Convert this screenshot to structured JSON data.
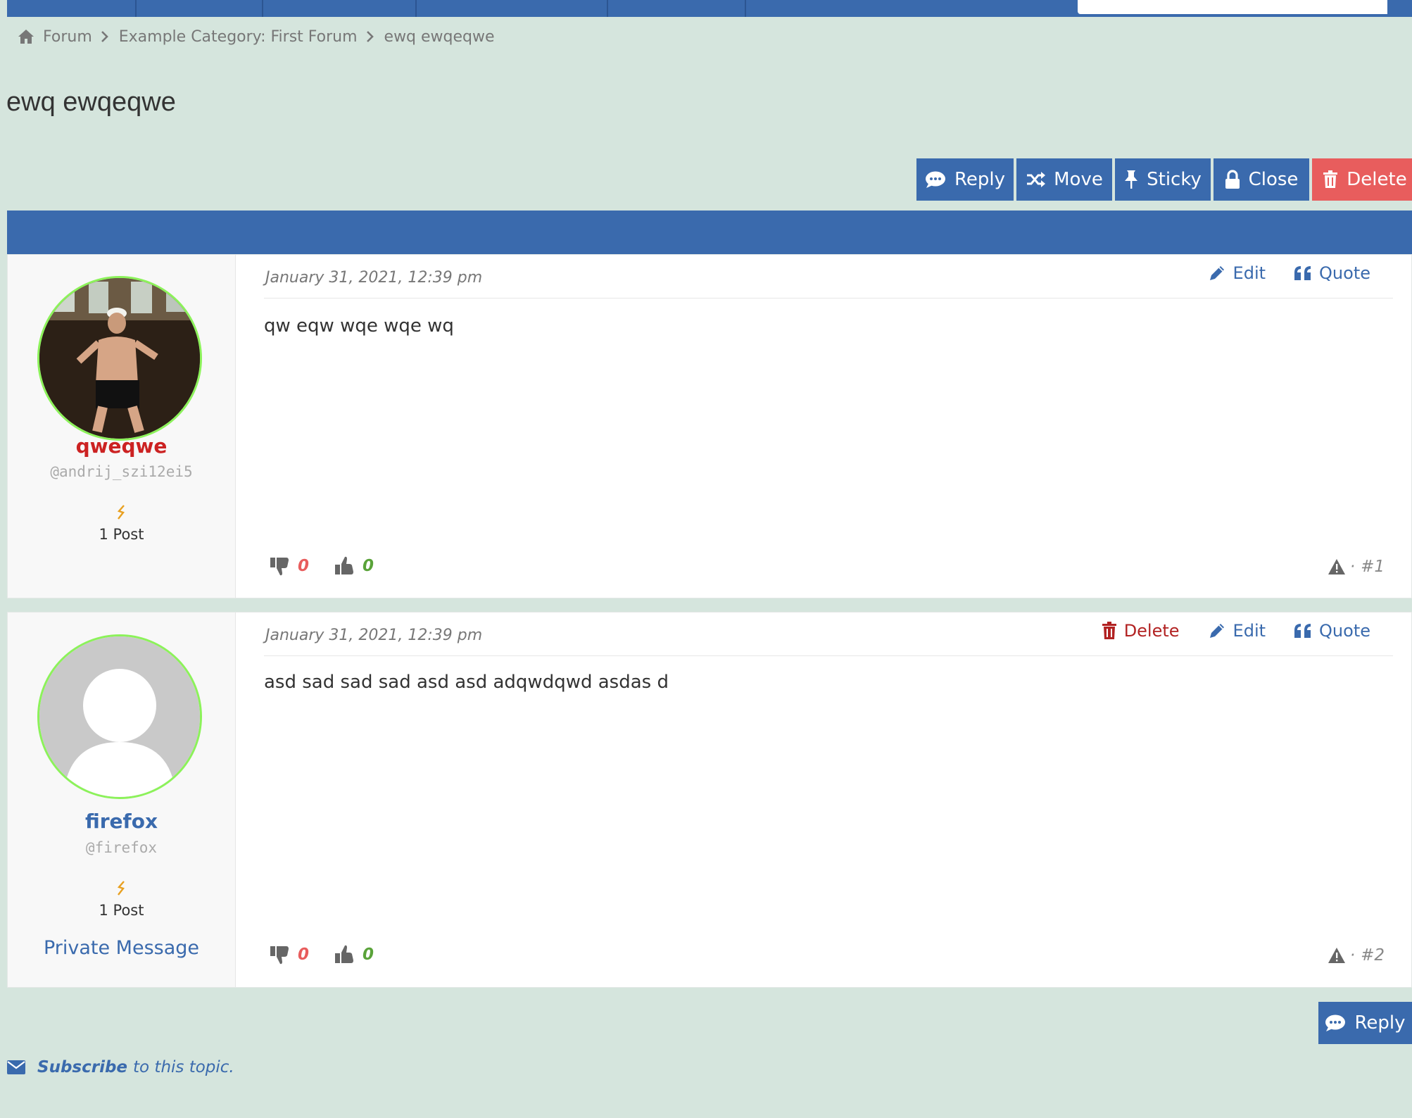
{
  "breadcrumb": {
    "home_label": "Forum",
    "category_label": "Example Category: First Forum",
    "topic_label": "ewq ewqeqwe"
  },
  "topic": {
    "title": "ewq ewqeqwe"
  },
  "actions": {
    "reply": "Reply",
    "move": "Move",
    "sticky": "Sticky",
    "close": "Close",
    "delete": "Delete"
  },
  "posts": [
    {
      "author_name": "qweqwe",
      "author_handle": "@andrij_szi12ei5",
      "post_count": "1 Post",
      "date": "January 31, 2021, 12:39 pm",
      "edit_label": "Edit",
      "quote_label": "Quote",
      "content": "qw eqw wqe wqe wq",
      "downvotes": "0",
      "upvotes": "0",
      "number": "#1"
    },
    {
      "author_name": "firefox",
      "author_handle": "@firefox",
      "post_count": "1 Post",
      "private_message_label": "Private Message",
      "date": "January 31, 2021, 12:39 pm",
      "delete_label": "Delete",
      "edit_label": "Edit",
      "quote_label": "Quote",
      "content": "asd sad sad sad asd asd adqwdqwd asdas d",
      "downvotes": "0",
      "upvotes": "0",
      "number": "#2"
    }
  ],
  "footer": {
    "reply_label": "Reply",
    "subscribe_link": "Subscribe",
    "subscribe_suffix": "to this topic."
  },
  "colors": {
    "background": "#d5e5dd",
    "primary": "#3a6aad",
    "danger": "#e85d5d",
    "admin_name": "#cc2222",
    "upvote": "#5aa33a",
    "avatar_ring": "#8cf25a"
  }
}
